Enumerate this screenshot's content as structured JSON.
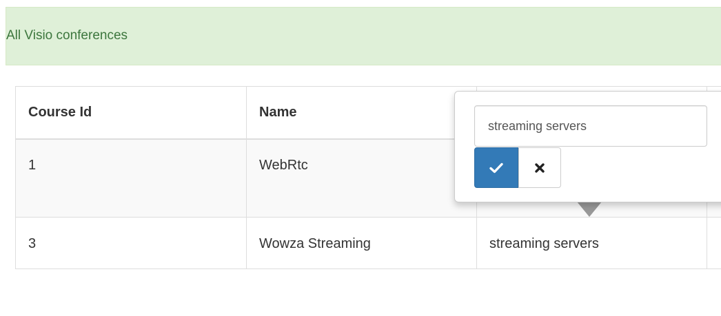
{
  "alert": {
    "text": "All Visio conferences"
  },
  "table": {
    "headers": [
      "Course Id",
      "Name",
      ""
    ],
    "rows": [
      {
        "course_id": "1",
        "name": "WebRtc",
        "description": ""
      },
      {
        "course_id": "3",
        "name": "Wowza Streaming",
        "description": "streaming servers"
      }
    ]
  },
  "popover": {
    "input_value": "streaming servers",
    "ok_icon": "check-icon",
    "cancel_icon": "close-icon"
  },
  "colors": {
    "alert_bg": "#dff0d8",
    "alert_text": "#3c763d",
    "primary": "#337ab7"
  }
}
